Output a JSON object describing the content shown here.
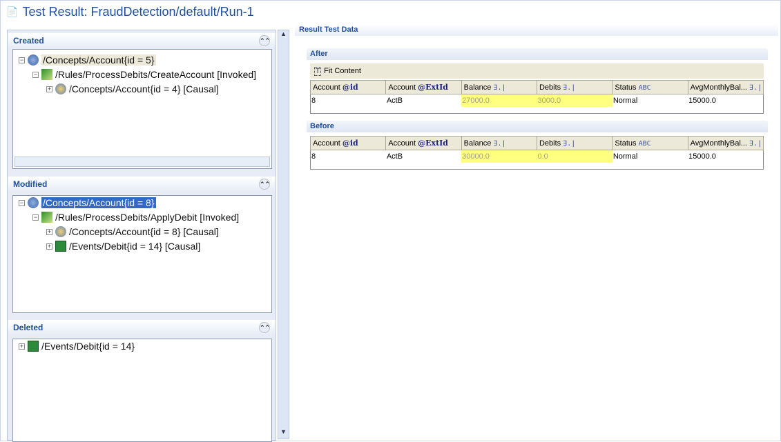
{
  "title": "Test Result: FraudDetection/default/Run-1",
  "sections": {
    "created": {
      "label": "Created",
      "nodes": [
        "/Concepts/Account{id = 5}",
        "/Rules/ProcessDebits/CreateAccount [Invoked]",
        "/Concepts/Account{id = 4} [Causal]"
      ]
    },
    "modified": {
      "label": "Modified",
      "nodes": [
        "/Concepts/Account{id = 8}",
        "/Rules/ProcessDebits/ApplyDebit [Invoked]",
        "/Concepts/Account{id = 8} [Causal]",
        "/Events/Debit{id = 14} [Causal]"
      ]
    },
    "deleted": {
      "label": "Deleted",
      "nodes": [
        "/Events/Debit{id = 14}"
      ]
    }
  },
  "result": {
    "title": "Result Test Data",
    "fit_content": "Fit Content",
    "columns": [
      {
        "name": "Account",
        "tag": "@id"
      },
      {
        "name": "Account",
        "tag": "@ExtId"
      },
      {
        "name": "Balance",
        "tag": "∃.|"
      },
      {
        "name": "Debits",
        "tag": "∃.|"
      },
      {
        "name": "Status",
        "tag": "ABC"
      },
      {
        "name": "AvgMonthlyBal...",
        "tag": "∃.|"
      }
    ],
    "after": {
      "label": "After",
      "row": [
        "8",
        "ActB",
        "27000.0",
        "3000.0",
        "Normal",
        "15000.0"
      ]
    },
    "before": {
      "label": "Before",
      "row": [
        "8",
        "ActB",
        "30000.0",
        "0.0",
        "Normal",
        "15000.0"
      ]
    }
  },
  "colors": {
    "accent": "#1f4e9c",
    "selection": "#316ac5",
    "changed": "#ffff80"
  }
}
